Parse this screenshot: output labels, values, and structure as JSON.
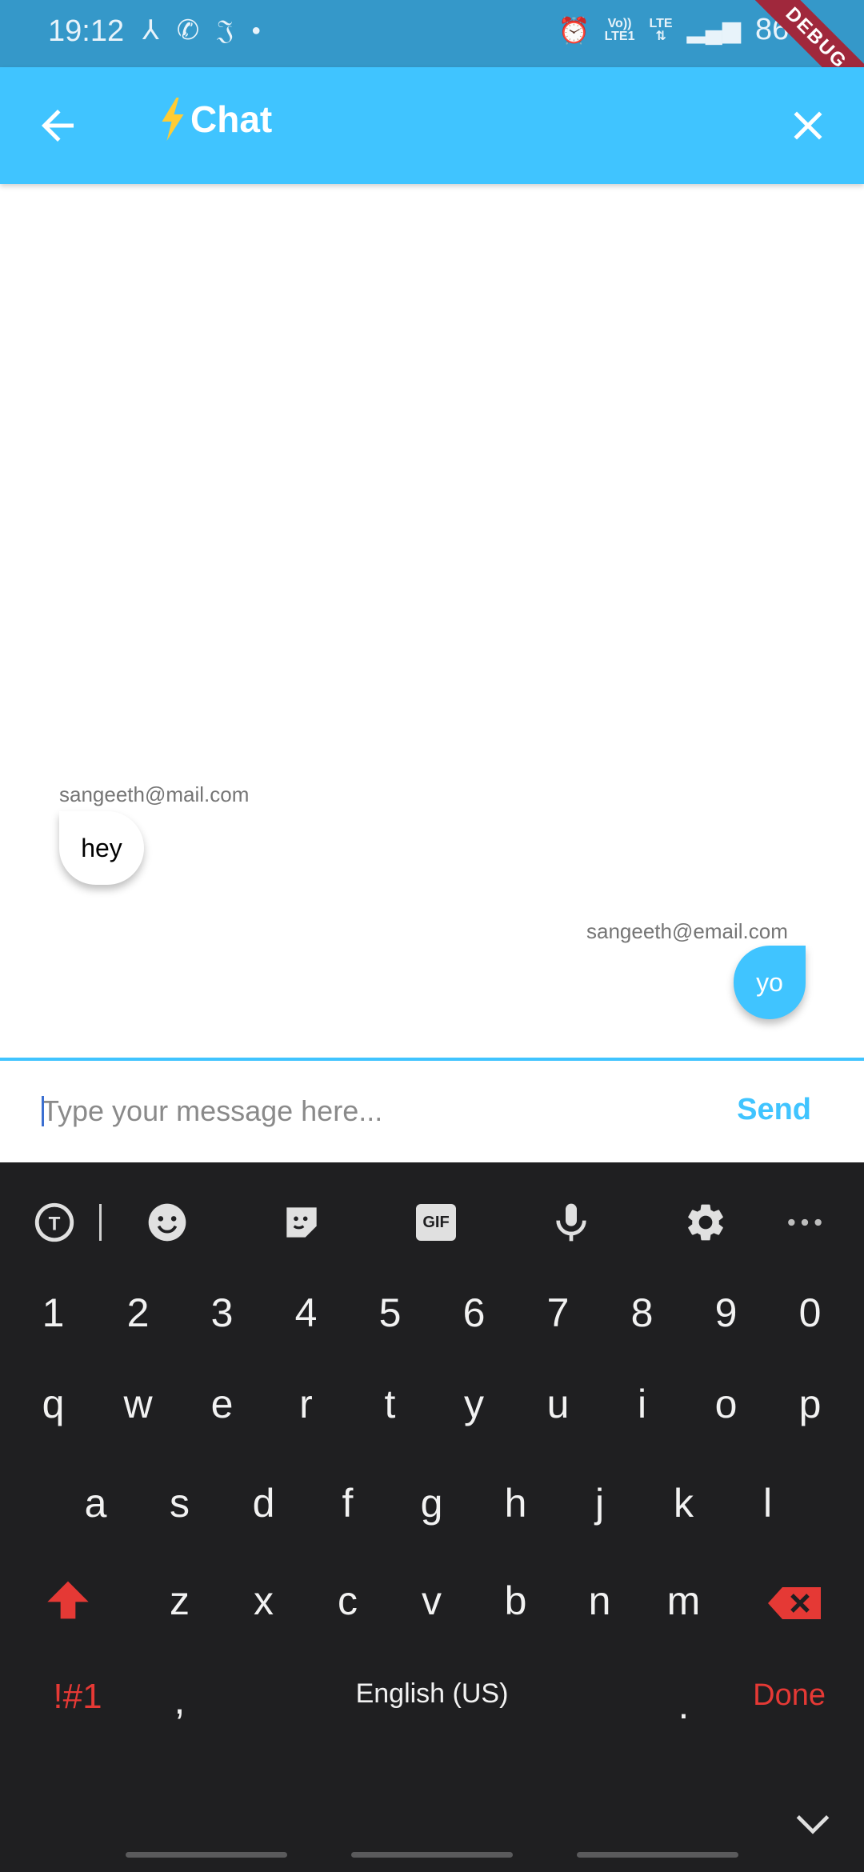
{
  "status_bar": {
    "time": "19:12",
    "volte": "Vo))",
    "lte_top": "LTE",
    "lte1": "LTE1",
    "battery": "86%",
    "debug_banner": "DEBUG"
  },
  "app_bar": {
    "title": "Chat",
    "title_icon": "lightning-bolt-icon",
    "back_icon": "arrow-left-icon",
    "close_icon": "close-icon",
    "color": "#40c4ff"
  },
  "messages": [
    {
      "sender": "sangeeth@mail.com",
      "text": "hey",
      "side": "left"
    },
    {
      "sender": "sangeeth@email.com",
      "text": "yo",
      "side": "right"
    }
  ],
  "composer": {
    "placeholder": "Type your message here...",
    "value": "",
    "send_label": "Send"
  },
  "keyboard": {
    "toolbar": [
      "text-translate-icon",
      "emoji-icon",
      "sticker-icon",
      "gif-icon",
      "mic-icon",
      "settings-icon",
      "more-icon"
    ],
    "gif_label": "GIF",
    "number_row": [
      "1",
      "2",
      "3",
      "4",
      "5",
      "6",
      "7",
      "8",
      "9",
      "0"
    ],
    "row1": [
      "q",
      "w",
      "e",
      "r",
      "t",
      "y",
      "u",
      "i",
      "o",
      "p"
    ],
    "row2": [
      "a",
      "s",
      "d",
      "f",
      "g",
      "h",
      "j",
      "k",
      "l"
    ],
    "row3": [
      "z",
      "x",
      "c",
      "v",
      "b",
      "n",
      "m"
    ],
    "symbols_label": "!#1",
    "comma": ",",
    "space_label": "English (US)",
    "period": ".",
    "done_label": "Done",
    "accent_color": "#e53935"
  }
}
